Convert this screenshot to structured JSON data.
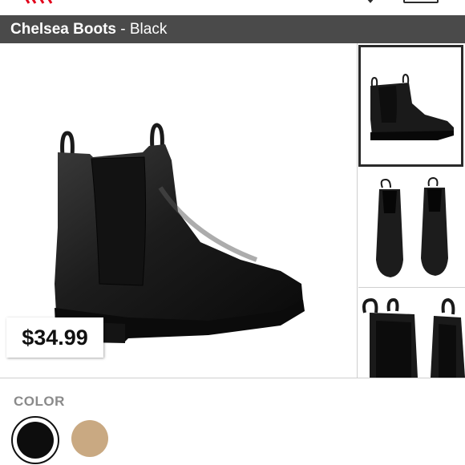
{
  "header": {
    "product_name": "Chelsea Boots",
    "separator": " - ",
    "variant": "Black"
  },
  "price": "$34.99",
  "color_section": {
    "label": "COLOR",
    "swatches": [
      {
        "name": "Black",
        "hex": "#0d0d0d",
        "selected": true
      },
      {
        "name": "Beige",
        "hex": "#c9a982",
        "selected": false
      }
    ]
  },
  "colors": {
    "title_bar": "#4a4a4a",
    "brand_red": "#e2001a"
  },
  "gallery": {
    "images": [
      "side-view",
      "top-pair-view",
      "back-detail-view"
    ],
    "selected_index": 0
  }
}
